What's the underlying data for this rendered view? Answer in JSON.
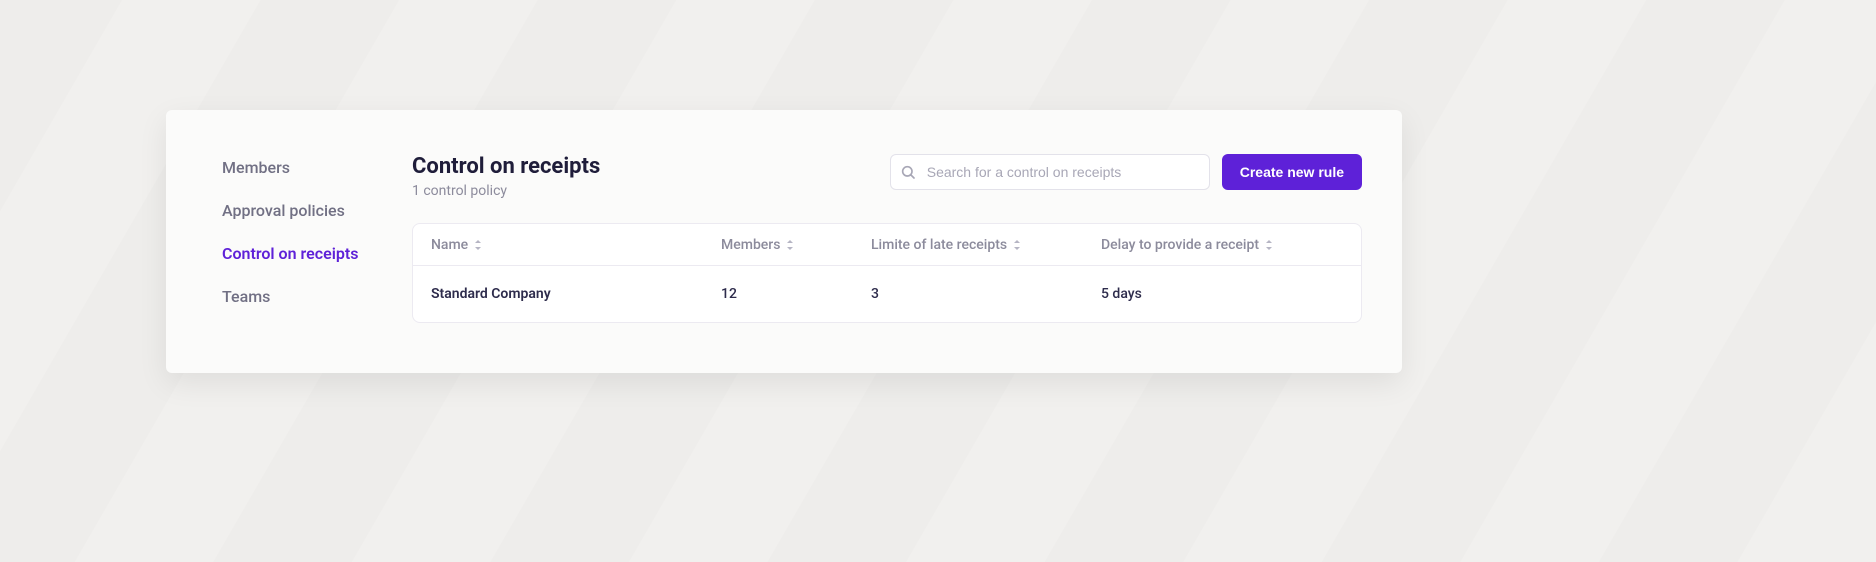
{
  "sidebar": {
    "items": [
      {
        "label": "Members",
        "active": false
      },
      {
        "label": "Approval policies",
        "active": false
      },
      {
        "label": "Control on receipts",
        "active": true
      },
      {
        "label": "Teams",
        "active": false
      }
    ]
  },
  "header": {
    "title": "Control on receipts",
    "subtitle": "1 control policy",
    "search_placeholder": "Search for a control on receipts",
    "create_label": "Create new rule"
  },
  "table": {
    "columns": [
      {
        "label": "Name"
      },
      {
        "label": "Members"
      },
      {
        "label": "Limite of late receipts"
      },
      {
        "label": "Delay to provide a receipt"
      }
    ],
    "rows": [
      {
        "name": "Standard Company",
        "members": "12",
        "limit": "3",
        "delay": "5 days"
      }
    ]
  }
}
